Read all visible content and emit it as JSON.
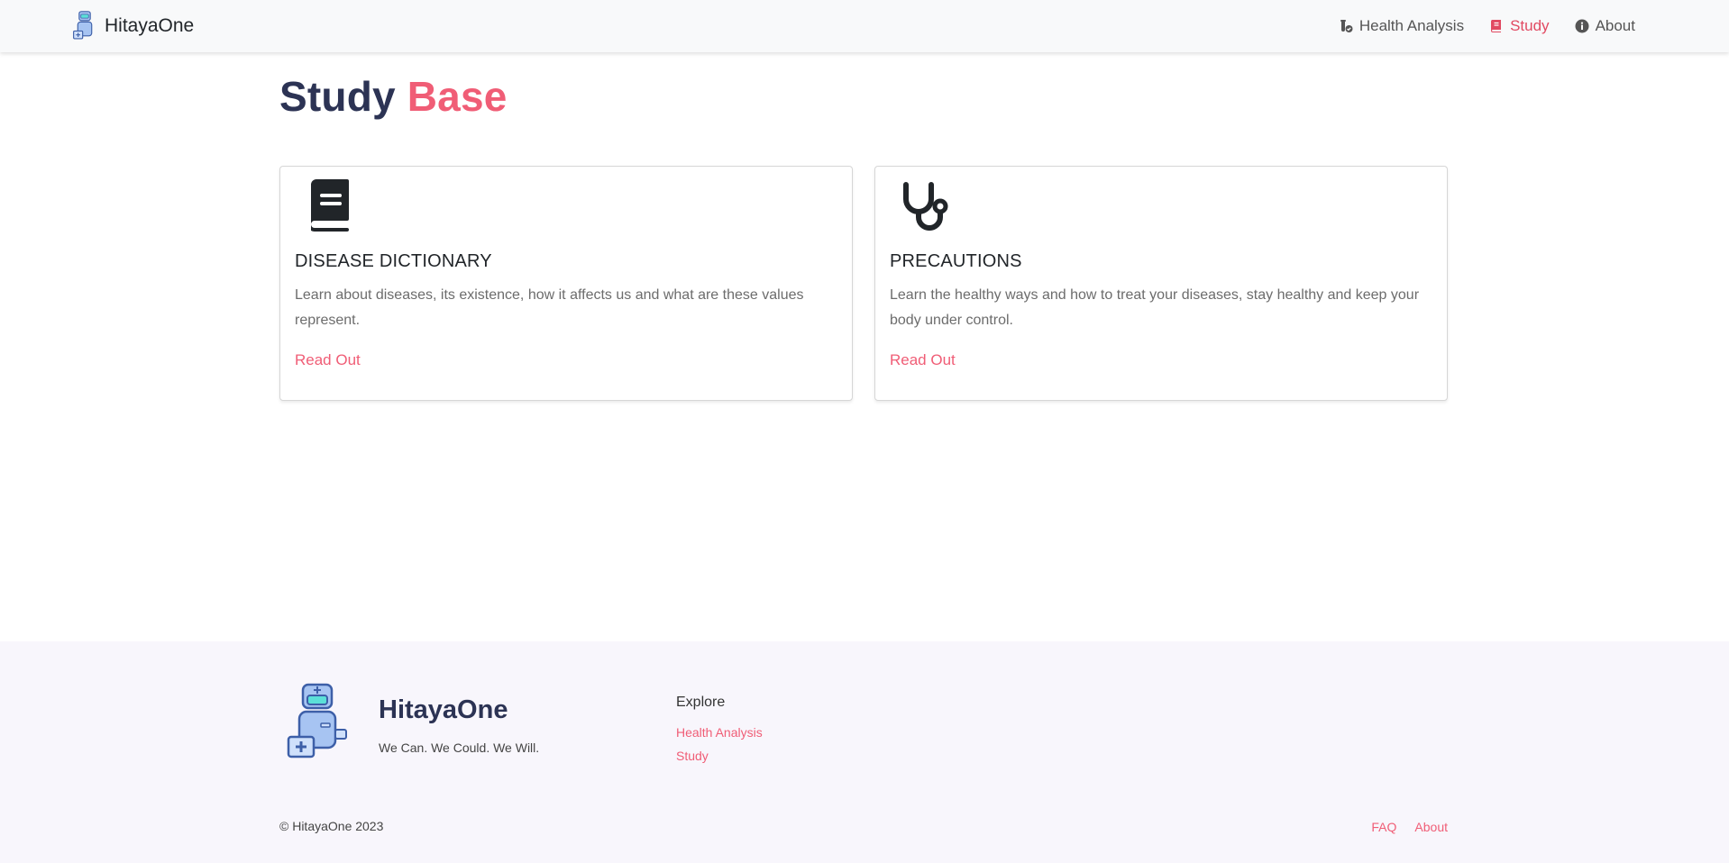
{
  "navbar": {
    "brand": "HitayaOne",
    "brand_logo_icon": "robot-doctor-icon",
    "items": [
      {
        "label": "Health Analysis",
        "icon": "vial-check-icon",
        "active": false
      },
      {
        "label": "Study",
        "icon": "book-icon",
        "active": true
      },
      {
        "label": "About",
        "icon": "info-circle-icon",
        "active": false
      }
    ]
  },
  "main": {
    "title_part1": "Study",
    "title_part2": "Base",
    "cards": [
      {
        "icon": "book-icon",
        "title": "DISEASE DICTIONARY",
        "text": "Learn about diseases, its existence, how it affects us and what are these values represent.",
        "link": "Read Out"
      },
      {
        "icon": "stethoscope-icon",
        "title": "PRECAUTIONS",
        "text": "Learn the healthy ways and how to treat your diseases, stay healthy and keep your body under control.",
        "link": "Read Out"
      }
    ]
  },
  "footer": {
    "brand": "HitayaOne",
    "tagline": "We Can. We Could. We Will.",
    "explore_heading": "Explore",
    "explore_links": [
      "Health Analysis",
      "Study"
    ],
    "copyright": "© HitayaOne 2023",
    "bottom_links": [
      "FAQ",
      "About"
    ]
  },
  "colors": {
    "accent": "#f05d76",
    "nav_active": "#e14a62",
    "title_dark": "#2c3354",
    "navbar_bg": "#f8f9fa",
    "footer_bg": "#f8f6fc"
  }
}
